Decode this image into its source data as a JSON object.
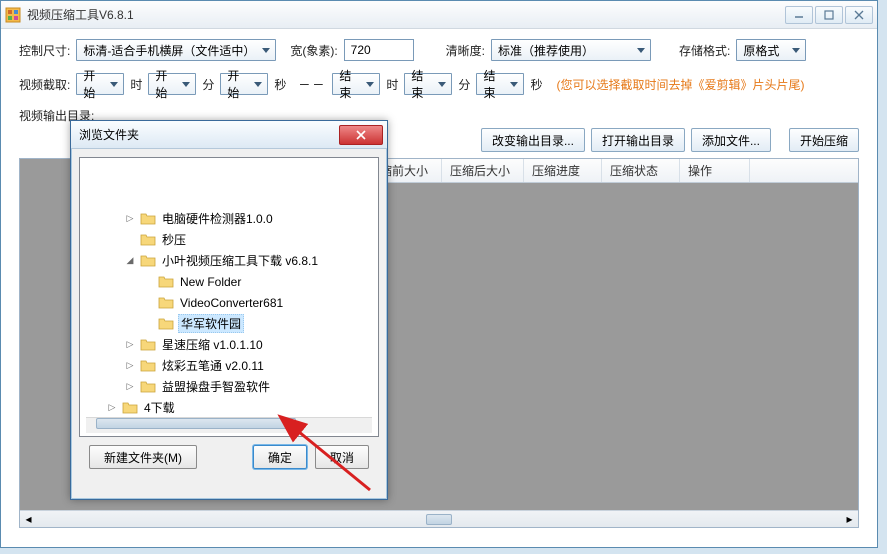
{
  "window": {
    "title": "视频压缩工具V6.8.1"
  },
  "row1": {
    "size_label": "控制尺寸:",
    "size_value": "标清-适合手机横屏（文件适中）",
    "width_label": "宽(象素):",
    "width_value": "720",
    "clarity_label": "清晰度:",
    "clarity_value": "标准（推荐使用）",
    "format_label": "存储格式:",
    "format_value": "原格式"
  },
  "row2": {
    "capture_label": "视频截取:",
    "start_h": "开始",
    "h_unit": "时",
    "start_m": "开始",
    "m_unit": "分",
    "start_s": "开始",
    "s_unit": "秒",
    "dash": "－－",
    "end_h": "结束",
    "end_m": "结束",
    "end_s": "结束",
    "note": "(您可以选择截取时间去掉《爱剪辑》片头片尾)"
  },
  "row3": {
    "output_label": "视频输出目录:"
  },
  "buttons": {
    "change_dir": "改变输出目录...",
    "open_dir": "打开输出目录",
    "add_file": "添加文件...",
    "start": "开始压缩"
  },
  "table": {
    "col_before": "压缩前大小",
    "col_after": "压缩后大小",
    "col_progress": "压缩进度",
    "col_status": "压缩状态",
    "col_action": "操作"
  },
  "dialog": {
    "title": "浏览文件夹",
    "items": [
      {
        "label": "电脑硬件检测器1.0.0",
        "indent": 2,
        "exp": "▷"
      },
      {
        "label": "秒压",
        "indent": 2,
        "exp": ""
      },
      {
        "label": "小叶视频压缩工具下载 v6.8.1",
        "indent": 2,
        "exp": "◢"
      },
      {
        "label": "New Folder",
        "indent": 3,
        "exp": ""
      },
      {
        "label": "VideoConverter681",
        "indent": 3,
        "exp": ""
      },
      {
        "label": "华军软件园",
        "indent": 3,
        "exp": "",
        "selected": true
      },
      {
        "label": "星速压缩 v1.0.1.10",
        "indent": 2,
        "exp": "▷"
      },
      {
        "label": "炫彩五笔通 v2.0.11",
        "indent": 2,
        "exp": "▷"
      },
      {
        "label": "益盟操盘手智盈软件",
        "indent": 2,
        "exp": "▷"
      },
      {
        "label": "4下载",
        "indent": 1,
        "exp": "▷"
      }
    ],
    "new_folder": "新建文件夹(M)",
    "ok": "确定",
    "cancel": "取消"
  }
}
